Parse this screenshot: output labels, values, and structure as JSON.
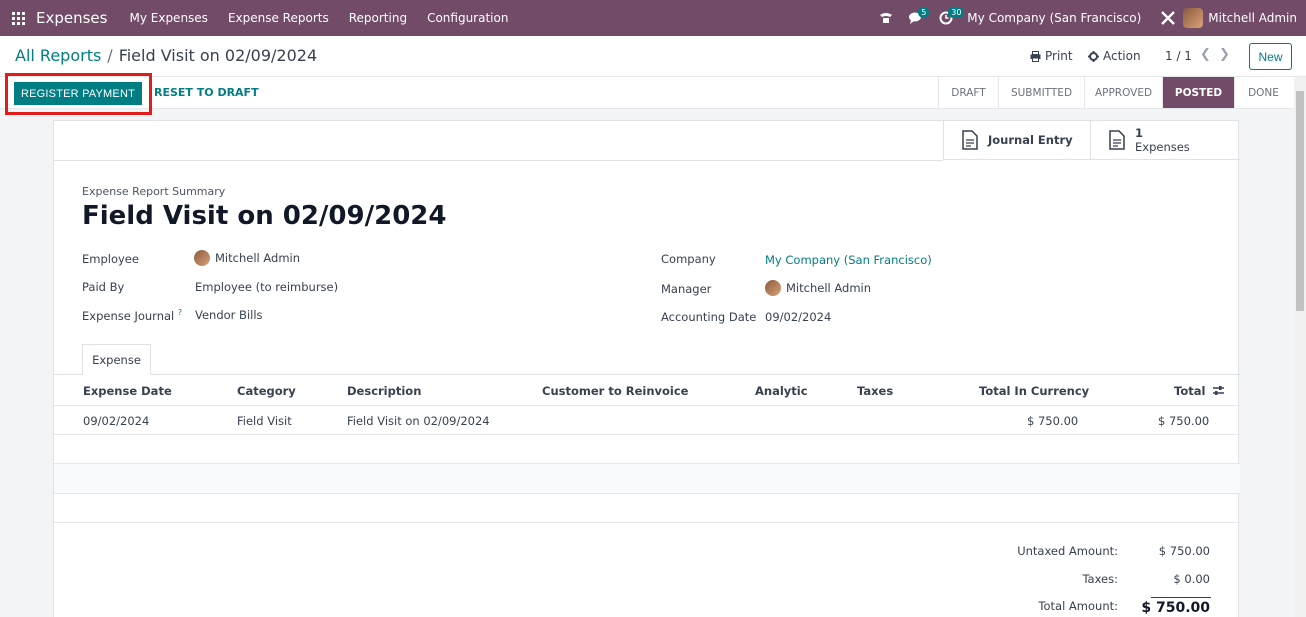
{
  "navbar": {
    "app_name": "Expenses",
    "menu": [
      "My Expenses",
      "Expense Reports",
      "Reporting",
      "Configuration"
    ],
    "messages_count": "5",
    "activities_count": "30",
    "company": "My Company (San Francisco)",
    "user": "Mitchell Admin"
  },
  "control": {
    "breadcrumb_parent": "All Reports",
    "breadcrumb_sep": "/",
    "breadcrumb_current": "Field Visit on 02/09/2024",
    "print_label": "Print",
    "action_label": "Action",
    "pager": "1 / 1",
    "new_label": "New"
  },
  "statusbar": {
    "register_payment": "REGISTER PAYMENT",
    "reset_to_draft": "RESET TO DRAFT",
    "stages": [
      "DRAFT",
      "SUBMITTED",
      "APPROVED",
      "POSTED",
      "DONE"
    ],
    "active_stage": "POSTED"
  },
  "smart_buttons": {
    "journal_entry": "Journal Entry",
    "expenses_count": "1",
    "expenses_label": "Expenses"
  },
  "form": {
    "subtitle": "Expense Report Summary",
    "title": "Field Visit on 02/09/2024",
    "employee_label": "Employee",
    "employee_value": "Mitchell Admin",
    "paid_by_label": "Paid By",
    "paid_by_value": "Employee (to reimburse)",
    "journal_label": "Expense Journal",
    "journal_help": "?",
    "journal_value": "Vendor Bills",
    "company_label": "Company",
    "company_value": "My Company (San Francisco)",
    "manager_label": "Manager",
    "manager_value": "Mitchell Admin",
    "accounting_date_label": "Accounting Date",
    "accounting_date_value": "09/02/2024"
  },
  "tab": {
    "label": "Expense"
  },
  "table": {
    "headers": [
      "Expense Date",
      "Category",
      "Description",
      "Customer to Reinvoice",
      "Analytic",
      "Taxes",
      "Total In Currency",
      "Total"
    ],
    "rows": [
      {
        "date": "09/02/2024",
        "category": "Field Visit",
        "description": "Field Visit on 02/09/2024",
        "total_currency": "$ 750.00",
        "total": "$ 750.00"
      }
    ]
  },
  "totals": {
    "untaxed_label": "Untaxed Amount:",
    "untaxed_value": "$ 750.00",
    "taxes_label": "Taxes:",
    "taxes_value": "$ 0.00",
    "total_label": "Total Amount:",
    "total_value": "$ 750.00"
  },
  "colors": {
    "brand": "#714b67",
    "accent": "#017e84",
    "highlight": "#e21b1b"
  }
}
